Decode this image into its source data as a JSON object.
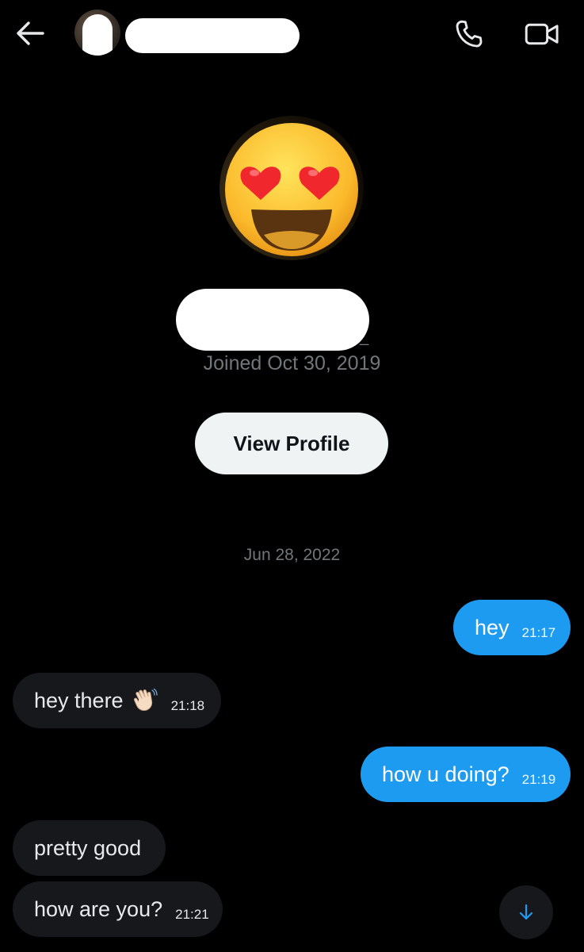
{
  "header": {
    "back_icon": "arrow-left-icon",
    "call_icon": "phone-icon",
    "video_icon": "video-camera-icon"
  },
  "profile": {
    "avatar_icon": "smiling-face-with-heart-eyes-emoji",
    "handle_suffix": "_",
    "joined": "Joined Oct 30, 2019",
    "view_profile_label": "View Profile"
  },
  "conversation": {
    "date_separator": "Jun 28, 2022",
    "messages": [
      {
        "direction": "outgoing",
        "text": "hey",
        "time": "21:17"
      },
      {
        "direction": "incoming",
        "text": "hey there",
        "emoji": "waving-hand-emoji",
        "time": "21:18"
      },
      {
        "direction": "outgoing",
        "text": "how u doing?",
        "time": "21:19"
      },
      {
        "direction": "incoming",
        "text": "pretty good",
        "time": ""
      },
      {
        "direction": "incoming",
        "text": "how are you?",
        "time": "21:21"
      }
    ]
  },
  "scroll_button": {
    "icon": "arrow-down-icon"
  },
  "colors": {
    "background": "#000000",
    "outgoing_bubble": "#1d9bf0",
    "incoming_bubble": "#16181c",
    "secondary_text": "#71767b",
    "view_profile_button": "#eff3f4"
  }
}
